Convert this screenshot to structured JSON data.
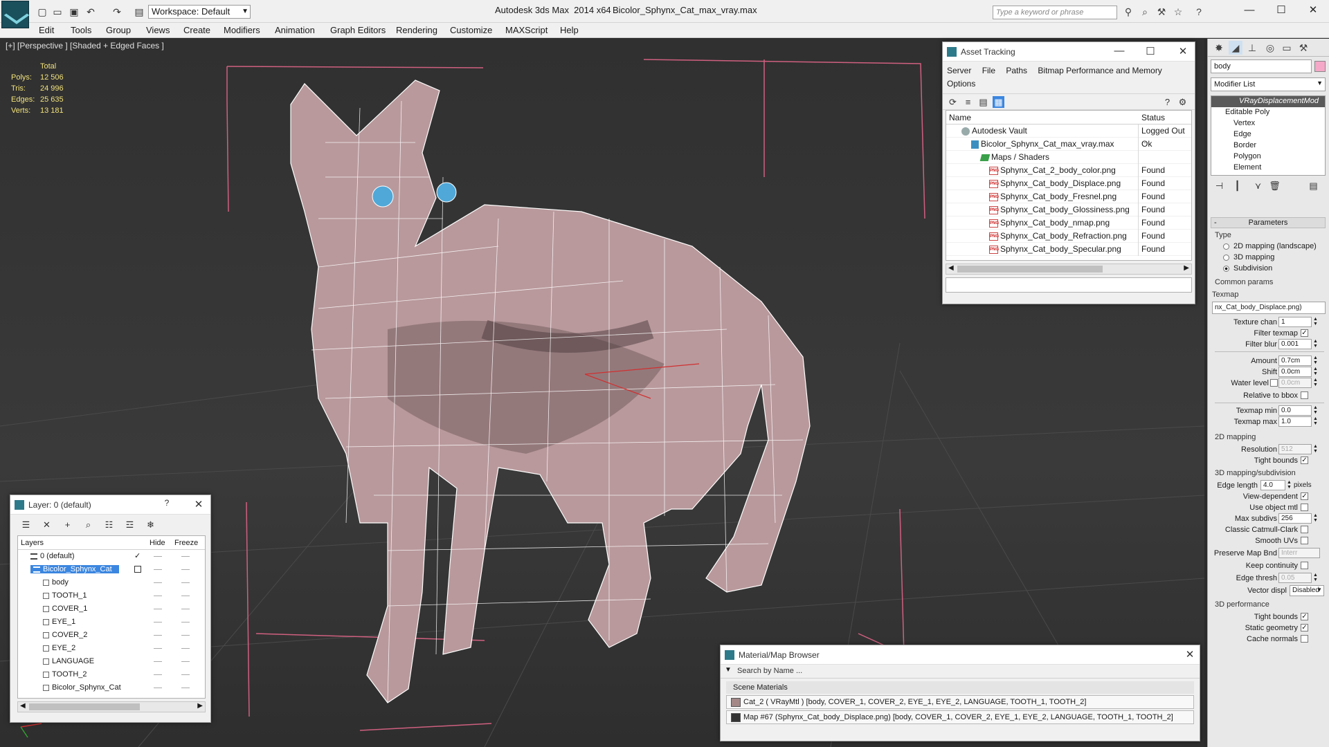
{
  "titlebar": {
    "workspace": "Workspace: Default",
    "app_title": "Autodesk 3ds Max  2014 x64",
    "file_title": "Bicolor_Sphynx_Cat_max_vray.max",
    "search_placeholder": "Type a keyword or phrase"
  },
  "menu": [
    "Edit",
    "Tools",
    "Group",
    "Views",
    "Create",
    "Modifiers",
    "Animation",
    "Graph Editors",
    "Rendering",
    "Customize",
    "MAXScript",
    "Help"
  ],
  "viewport": {
    "label": "[+] [Perspective ] [Shaded + Edged Faces ]",
    "stats": {
      "total_label": "Total",
      "polys_label": "Polys:",
      "polys": "12 506",
      "tris_label": "Tris:",
      "tris": "24 996",
      "edges_label": "Edges:",
      "edges": "25 635",
      "verts_label": "Verts:",
      "verts": "13 181"
    }
  },
  "asset_tracking": {
    "title": "Asset Tracking",
    "menu": [
      "Server",
      "File",
      "Paths",
      "Bitmap Performance and Memory",
      "Options"
    ],
    "col_name": "Name",
    "col_status": "Status",
    "rows": [
      {
        "name": "Autodesk Vault",
        "status": "Logged Out ...",
        "kind": "vault"
      },
      {
        "name": "Bicolor_Sphynx_Cat_max_vray.max",
        "status": "Ok",
        "kind": "max"
      },
      {
        "name": "Maps / Shaders",
        "status": "",
        "kind": "folder"
      },
      {
        "name": "Sphynx_Cat_2_body_color.png",
        "status": "Found",
        "kind": "png"
      },
      {
        "name": "Sphynx_Cat_body_Displace.png",
        "status": "Found",
        "kind": "png"
      },
      {
        "name": "Sphynx_Cat_body_Fresnel.png",
        "status": "Found",
        "kind": "png"
      },
      {
        "name": "Sphynx_Cat_body_Glossiness.png",
        "status": "Found",
        "kind": "png"
      },
      {
        "name": "Sphynx_Cat_body_nmap.png",
        "status": "Found",
        "kind": "png"
      },
      {
        "name": "Sphynx_Cat_body_Refraction.png",
        "status": "Found",
        "kind": "png"
      },
      {
        "name": "Sphynx_Cat_body_Specular.png",
        "status": "Found",
        "kind": "png"
      }
    ],
    "png_badge": "PNG"
  },
  "layers": {
    "title": "Layer: 0 (default)",
    "help": "?",
    "col_layers": "Layers",
    "col_hide": "Hide",
    "col_freeze": "Freeze",
    "rows": [
      {
        "name": "0 (default)",
        "kind": "layer"
      },
      {
        "name": "Bicolor_Sphynx_Cat",
        "kind": "layer-selected"
      },
      {
        "name": "body",
        "kind": "object"
      },
      {
        "name": "TOOTH_1",
        "kind": "object"
      },
      {
        "name": "COVER_1",
        "kind": "object"
      },
      {
        "name": "EYE_1",
        "kind": "object"
      },
      {
        "name": "COVER_2",
        "kind": "object"
      },
      {
        "name": "EYE_2",
        "kind": "object"
      },
      {
        "name": "LANGUAGE",
        "kind": "object"
      },
      {
        "name": "TOOTH_2",
        "kind": "object"
      },
      {
        "name": "Bicolor_Sphynx_Cat",
        "kind": "object"
      }
    ]
  },
  "material_browser": {
    "title": "Material/Map Browser",
    "search": "Search by Name ...",
    "section": "Scene Materials",
    "items": [
      "Cat_2  ( VRayMtl ) [body, COVER_1, COVER_2, EYE_1, EYE_2, LANGUAGE, TOOTH_1, TOOTH_2]",
      "Map #67 (Sphynx_Cat_body_Displace.png) [body, COVER_1, COVER_2, EYE_1, EYE_2, LANGUAGE, TOOTH_1, TOOTH_2]"
    ]
  },
  "command_panel": {
    "object_name": "body",
    "object_color": "#f5a8c8",
    "modifier_list": "Modifier List",
    "stack": [
      {
        "label": "VRayDisplacementMod",
        "level": 0,
        "highlight": true
      },
      {
        "label": "Editable Poly",
        "level": 0,
        "highlight": false
      },
      {
        "label": "Vertex",
        "level": 1,
        "highlight": false
      },
      {
        "label": "Edge",
        "level": 1,
        "highlight": false
      },
      {
        "label": "Border",
        "level": 1,
        "highlight": false
      },
      {
        "label": "Polygon",
        "level": 1,
        "highlight": false
      },
      {
        "label": "Element",
        "level": 1,
        "highlight": false
      }
    ],
    "params_title": "Parameters",
    "type_label": "Type",
    "type_options": [
      "2D mapping (landscape)",
      "3D mapping",
      "Subdivision"
    ],
    "type_selected": "Subdivision",
    "common_label": "Common params",
    "texmap_label": "Texmap",
    "texmap_value": "nx_Cat_body_Displace.png)",
    "texture_chan_label": "Texture chan",
    "texture_chan": "1",
    "filter_texmap_label": "Filter texmap",
    "filter_blur_label": "Filter blur",
    "filter_blur": "0.001",
    "amount_label": "Amount",
    "amount": "0.7cm",
    "shift_label": "Shift",
    "shift": "0.0cm",
    "water_level_label": "Water level",
    "water_level": "0.0cm",
    "relative_bbox_label": "Relative to bbox",
    "texmap_min_label": "Texmap min",
    "texmap_min": "0.0",
    "texmap_max_label": "Texmap max",
    "texmap_max": "1.0",
    "mapping2d_label": "2D mapping",
    "resolution_label": "Resolution",
    "resolution": "512",
    "tight_bounds_label": "Tight bounds",
    "mapping3d_label": "3D mapping/subdivision",
    "edge_length_label": "Edge length",
    "edge_length": "4.0",
    "pixels_label": "pixels",
    "view_dependent_label": "View-dependent",
    "use_object_mtl_label": "Use object mtl",
    "max_subdivs_label": "Max subdivs",
    "max_subdivs": "256",
    "catmull_label": "Classic Catmull-Clark",
    "smooth_uvs_label": "Smooth UVs",
    "preserve_label": "Preserve Map Bnd",
    "preserve_value": "Interr",
    "keep_continuity_label": "Keep continuity",
    "edge_thresh_label": "Edge thresh",
    "edge_thresh": "0.05",
    "vector_disp_label": "Vector displ",
    "vector_disp": "Disabled",
    "perf_label": "3D performance",
    "perf_tight_bounds_label": "Tight bounds",
    "static_geometry_label": "Static geometry",
    "cache_normals_label": "Cache normals"
  }
}
